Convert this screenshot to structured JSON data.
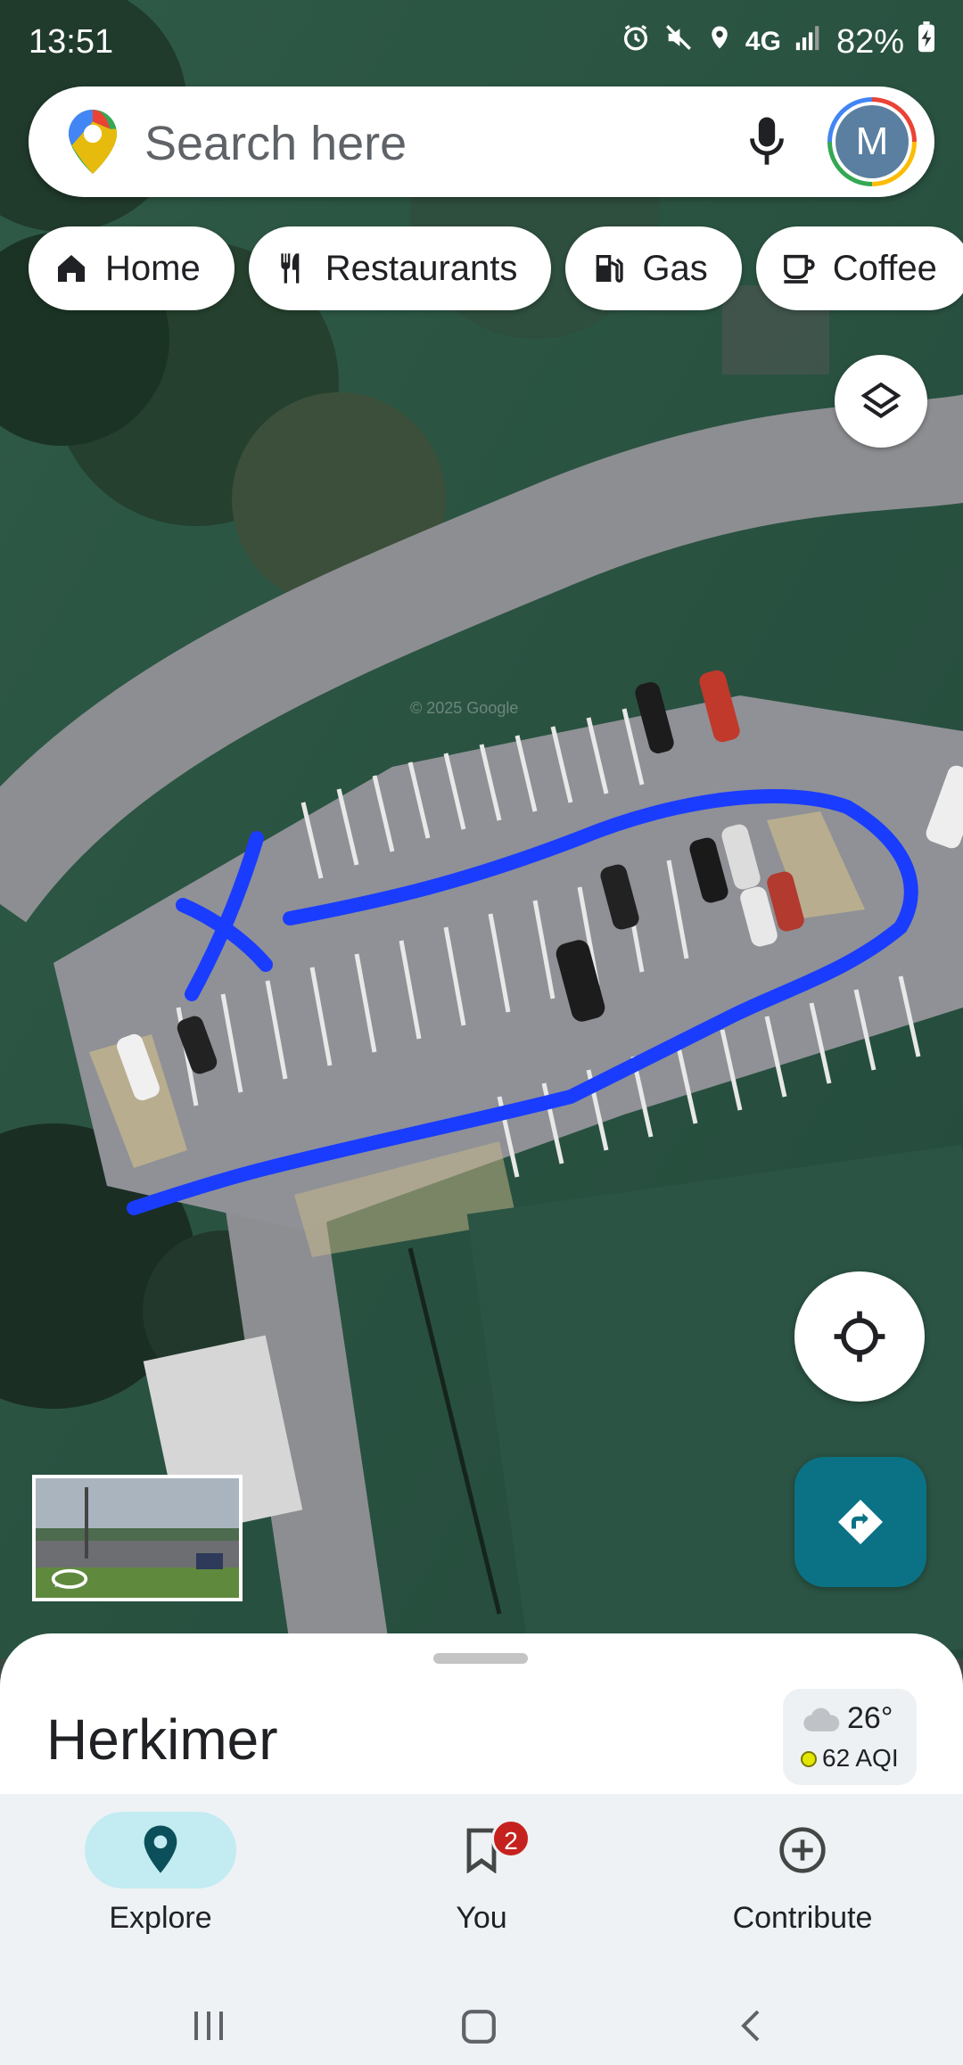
{
  "status_bar": {
    "time": "13:51",
    "battery": "82%",
    "network": "4G"
  },
  "search": {
    "placeholder": "Search here",
    "avatar_initial": "M"
  },
  "chips": [
    {
      "label": "Home",
      "icon": "home-icon"
    },
    {
      "label": "Restaurants",
      "icon": "fork-knife-icon"
    },
    {
      "label": "Gas",
      "icon": "gas-pump-icon"
    },
    {
      "label": "Coffee",
      "icon": "coffee-cup-icon"
    }
  ],
  "map": {
    "watermark": "© 2025 Google"
  },
  "sheet": {
    "place_name": "Herkimer",
    "weather": {
      "temperature": "26°",
      "aqi": "62 AQI"
    }
  },
  "bottom_nav": [
    {
      "label": "Explore",
      "icon": "location-pin-icon",
      "active": true
    },
    {
      "label": "You",
      "icon": "bookmark-icon",
      "badge": "2"
    },
    {
      "label": "Contribute",
      "icon": "add-circle-icon"
    }
  ],
  "colors": {
    "annotation_stroke": "#1a3cff",
    "directions_button": "#0b7285",
    "explore_active_pill": "#c3ebf2"
  }
}
